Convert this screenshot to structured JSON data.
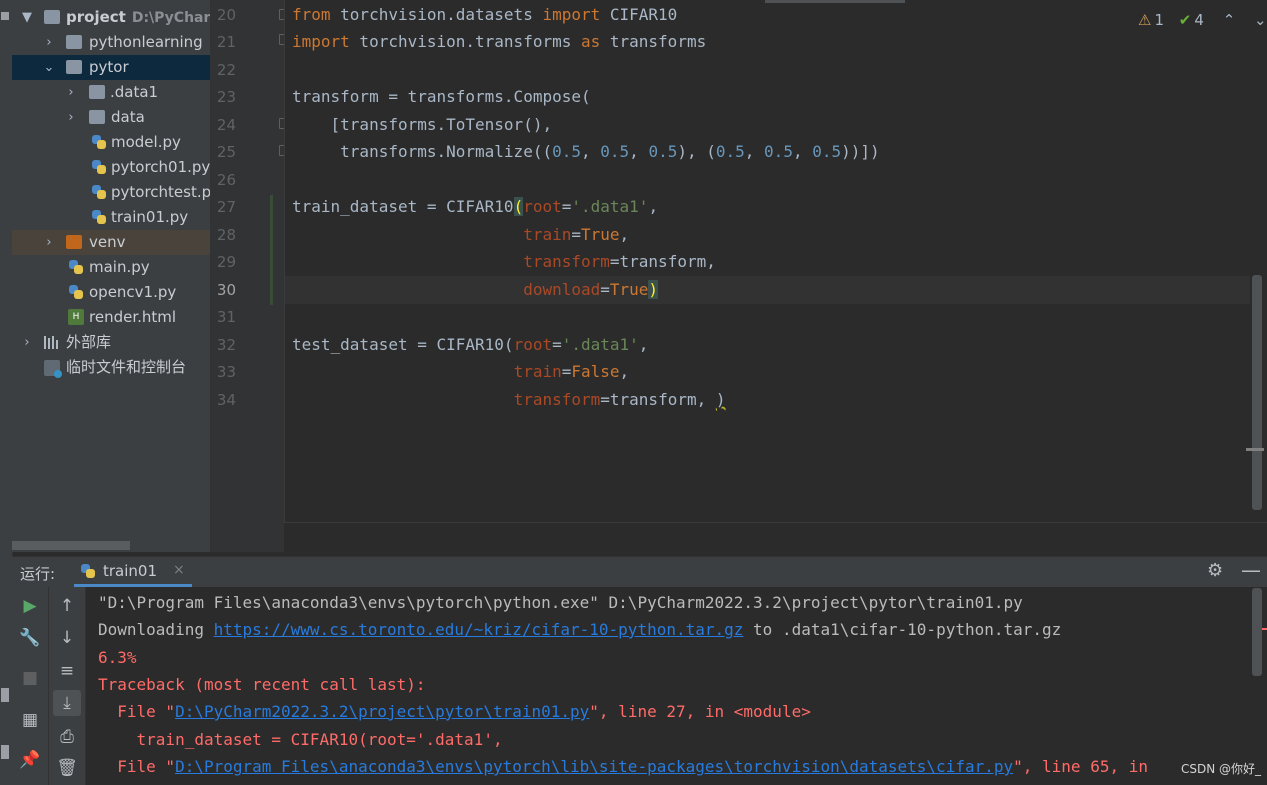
{
  "project_tree": {
    "root": {
      "name": "project",
      "path": "D:\\PyCharm"
    },
    "items": [
      {
        "label": "pythonlearning",
        "kind": "folder"
      },
      {
        "label": "pytor",
        "kind": "folder"
      },
      {
        "label": ".data1",
        "kind": "folder"
      },
      {
        "label": "data",
        "kind": "folder"
      },
      {
        "label": "model.py",
        "kind": "python-file"
      },
      {
        "label": "pytorch01.py",
        "kind": "python-file"
      },
      {
        "label": "pytorchtest.p",
        "kind": "python-file"
      },
      {
        "label": "train01.py",
        "kind": "python-file"
      },
      {
        "label": "venv",
        "kind": "folder-excluded"
      },
      {
        "label": "main.py",
        "kind": "python-file"
      },
      {
        "label": "opencv1.py",
        "kind": "python-file"
      },
      {
        "label": "render.html",
        "kind": "html-file"
      },
      {
        "label": "外部库",
        "kind": "libraries"
      },
      {
        "label": "临时文件和控制台",
        "kind": "scratches"
      }
    ]
  },
  "editor": {
    "current_line": "30",
    "inspections": {
      "warnings": "1",
      "weak_warnings": "4"
    },
    "line_numbers": [
      "20",
      "21",
      "22",
      "23",
      "24",
      "25",
      "26",
      "27",
      "28",
      "29",
      "30",
      "31",
      "32",
      "33",
      "34"
    ],
    "code": {
      "l20": {
        "kw1": "from",
        "t1": " torchvision.datasets ",
        "kw2": "import",
        "t2": " CIFAR10"
      },
      "l21": {
        "kw1": "import",
        "t1": " torchvision.transforms ",
        "kw2": "as",
        "t2": " transforms"
      },
      "l23": {
        "t1": "transform = transforms.Compose("
      },
      "l24": {
        "t1": "    [transforms.ToTensor(),"
      },
      "l25": {
        "t1": "     transforms.Normalize((",
        "n1": "0.5",
        "c1": ", ",
        "n2": "0.5",
        "c2": ", ",
        "n3": "0.5",
        "c3": "), (",
        "n4": "0.5",
        "c4": ", ",
        "n5": "0.5",
        "c5": ", ",
        "n6": "0.5",
        "t2": "))])"
      },
      "l27": {
        "t1": "train_dataset = CIFAR10",
        "b1": "(",
        "p1": "root",
        "eq": "=",
        "s1": "'.data1'",
        "t2": ","
      },
      "l28": {
        "indent": "                        ",
        "p1": "train",
        "eq": "=",
        "kw1": "True",
        "t2": ","
      },
      "l29": {
        "indent": "                        ",
        "p1": "transform",
        "t1": "=transform,"
      },
      "l30": {
        "indent": "                        ",
        "p1": "download",
        "eq": "=",
        "kw1": "True",
        "b1": ")"
      },
      "l32": {
        "t1": "test_dataset = CIFAR10(",
        "p1": "root",
        "eq": "=",
        "s1": "'.data1'",
        "t2": ","
      },
      "l33": {
        "indent": "                       ",
        "p1": "train",
        "eq": "=",
        "kw1": "False",
        "t2": ","
      },
      "l34": {
        "indent": "                       ",
        "p1": "transform",
        "t1": "=transform, ",
        "u1": ")"
      }
    }
  },
  "run_panel": {
    "label": "运行:",
    "tab": "train01",
    "close": "×",
    "console": {
      "cmd": "\"D:\\Program Files\\anaconda3\\envs\\pytorch\\python.exe\" D:\\PyCharm2022.3.2\\project\\pytor\\train01.py",
      "dl_prefix": "Downloading ",
      "dl_url": "https://www.cs.toronto.edu/~kriz/cifar-10-python.tar.gz",
      "dl_suffix": " to .data1\\cifar-10-python.tar.gz",
      "progress": "6.3%",
      "traceback": "Traceback (most recent call last):",
      "file1_prefix": "  File \"",
      "file1_link": "D:\\PyCharm2022.3.2\\project\\pytor\\train01.py",
      "file1_suffix": "\", line 27, in <module>",
      "code1": "    train_dataset = CIFAR10(root='.data1',",
      "file2_prefix": "  File \"",
      "file2_link": "D:\\Program Files\\anaconda3\\envs\\pytorch\\lib\\site-packages\\torchvision\\datasets\\cifar.py",
      "file2_suffix": "\", line 65, in"
    }
  },
  "watermark": "CSDN @你好_",
  "icons": {
    "warning": "warning-triangle-icon",
    "check": "double-check-icon",
    "settings": "gear-icon",
    "hide": "minimize-icon"
  },
  "colors": {
    "keyword": "#cc7832",
    "string": "#6a8759",
    "number": "#6897bb",
    "param": "#aa4926",
    "error": "#ff6b68",
    "link": "#287bde",
    "selection": "#0d293e"
  }
}
